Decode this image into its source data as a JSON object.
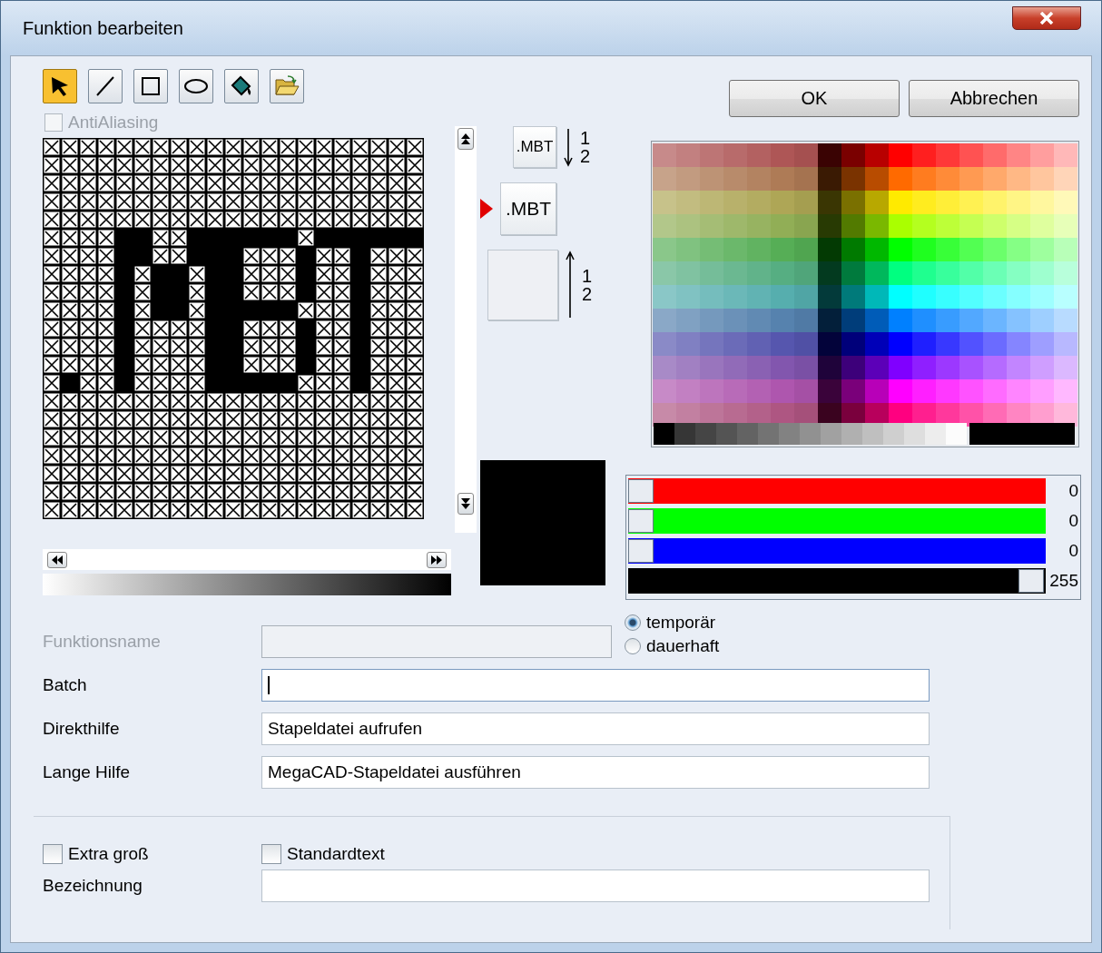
{
  "window": {
    "title": "Funktion bearbeiten"
  },
  "tools": [
    {
      "kind": "pointer",
      "selected": true
    },
    {
      "kind": "line",
      "selected": false
    },
    {
      "kind": "rectangle",
      "selected": false
    },
    {
      "kind": "ellipse",
      "selected": false
    },
    {
      "kind": "fill",
      "selected": false
    },
    {
      "kind": "open",
      "selected": false
    }
  ],
  "antialiasing": {
    "label": "AntiAliasing",
    "checked": false,
    "disabled": true
  },
  "buttons": [
    "OK",
    "Abbrechen"
  ],
  "previews": [
    {
      "kind": "down",
      "text": ".MBT",
      "numbers": [
        "1",
        "2"
      ],
      "selected": false
    },
    {
      "kind": "none",
      "text": ".MBT",
      "selected": true
    },
    {
      "kind": "up",
      "numbers": [
        "1",
        "2"
      ],
      "selected": false
    }
  ],
  "color_sliders": [
    {
      "kind": "red",
      "level": 0,
      "reading": "0"
    },
    {
      "kind": "green",
      "level": 0,
      "reading": "0"
    },
    {
      "kind": "blue",
      "level": 0,
      "reading": "0"
    },
    {
      "kind": "alpha",
      "level": 1,
      "reading": "255"
    }
  ],
  "form": {
    "name": {
      "label": "Funktionsname",
      "disabled": true
    },
    "persistence": [
      {
        "label": "temporär",
        "selected": true
      },
      {
        "label": "dauerhaft",
        "selected": false
      }
    ],
    "fields": [
      {
        "label": "Batch",
        "focused": true
      },
      {
        "label": "Direkthilfe",
        "value": "Stapeldatei aufrufen",
        "focused": false
      },
      {
        "label": "Lange Hilfe",
        "value": "MegaCAD-Stapeldatei ausführen",
        "focused": false
      }
    ]
  },
  "extras": {
    "checkboxes": [
      {
        "label": "Extra groß",
        "checked": false
      },
      {
        "label": "Standardtext",
        "checked": false
      }
    ],
    "field": {
      "label": "Bezeichnung"
    }
  }
}
